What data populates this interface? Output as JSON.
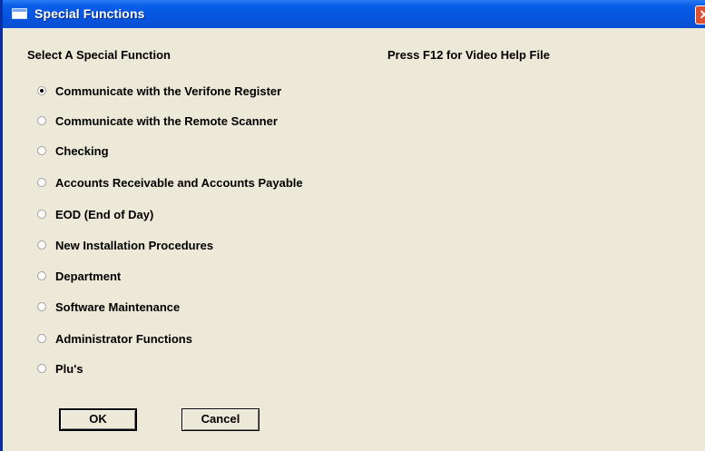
{
  "window": {
    "title": "Special Functions",
    "close_label": "✕"
  },
  "main": {
    "heading": "Select A Special Function",
    "help_text": "Press F12 for Video Help File",
    "options": [
      {
        "label": "Communicate with the Verifone Register",
        "selected": true
      },
      {
        "label": "Communicate with the Remote Scanner",
        "selected": false
      },
      {
        "label": "Checking",
        "selected": false
      },
      {
        "label": "Accounts Receivable and Accounts Payable",
        "selected": false
      },
      {
        "label": "EOD (End of Day)",
        "selected": false
      },
      {
        "label": "New Installation Procedures",
        "selected": false
      },
      {
        "label": "Department",
        "selected": false
      },
      {
        "label": "Software Maintenance",
        "selected": false
      },
      {
        "label": "Administrator Functions",
        "selected": false
      },
      {
        "label": "Plu's",
        "selected": false
      }
    ]
  },
  "buttons": {
    "ok": "OK",
    "cancel": "Cancel"
  }
}
